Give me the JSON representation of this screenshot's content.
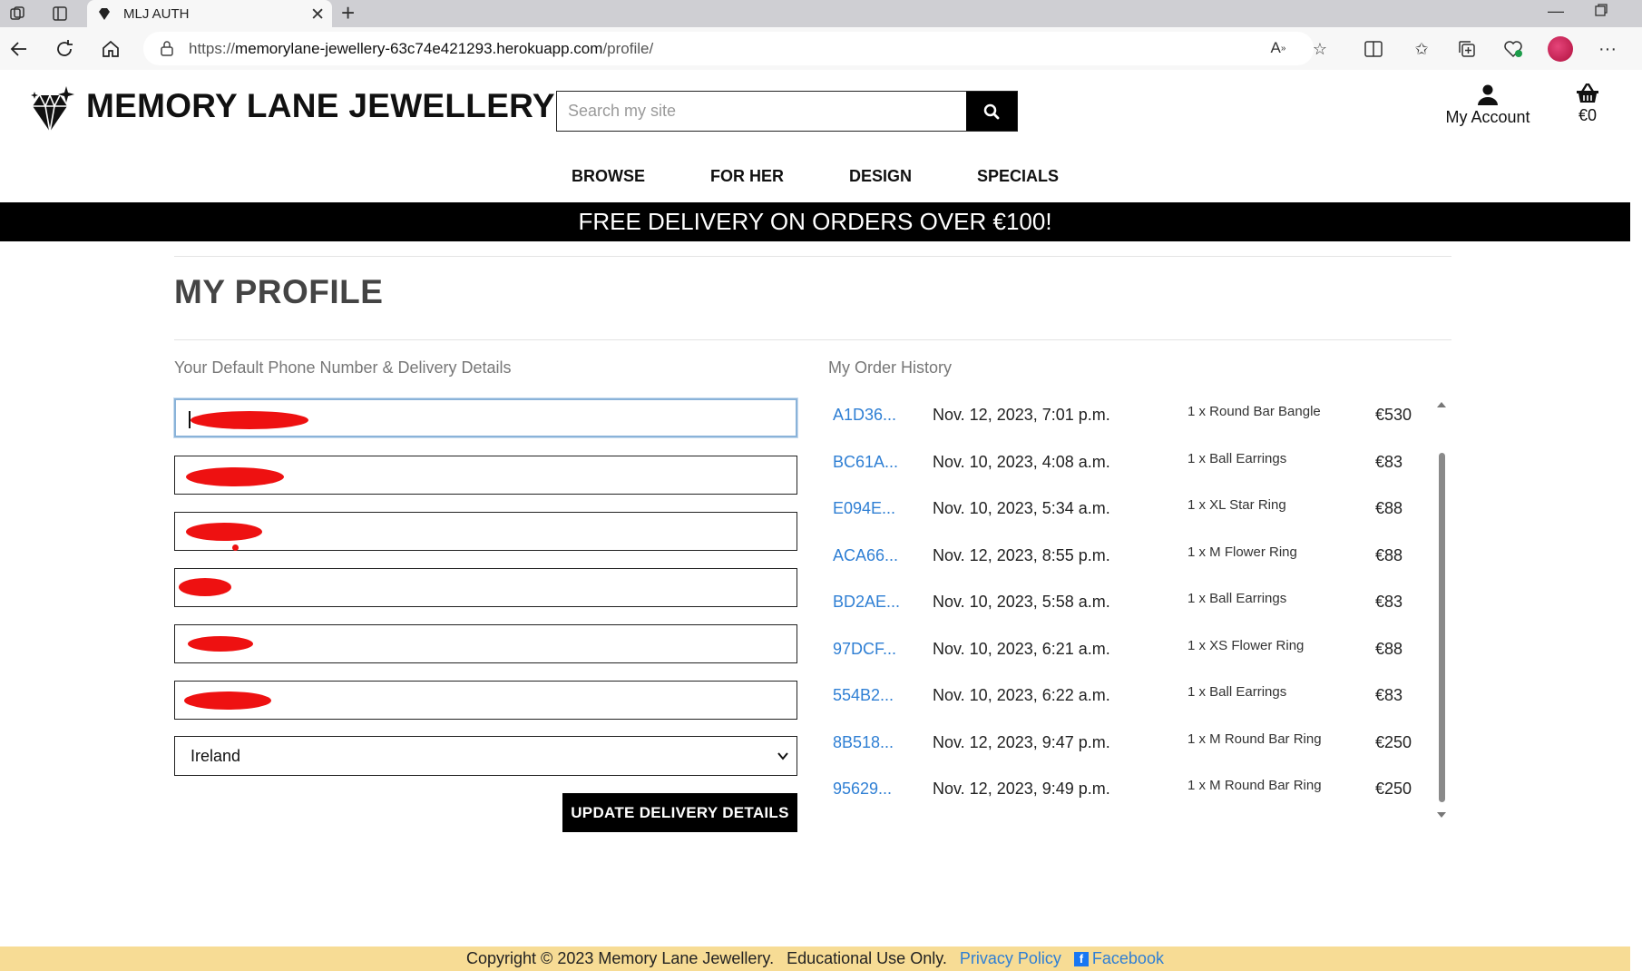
{
  "browser": {
    "tab_title": "MLJ AUTH",
    "url_prefix": "https://",
    "url_host": "memorylane-jewellery-63c74e421293.herokuapp.com",
    "url_path": "/profile/"
  },
  "header": {
    "brand": "MEMORY LANE JEWELLERY",
    "search_placeholder": "Search my site",
    "account_label": "My Account",
    "bag_total": "€0"
  },
  "nav": {
    "items": [
      {
        "label": "BROWSE"
      },
      {
        "label": "FOR HER"
      },
      {
        "label": "DESIGN"
      },
      {
        "label": "SPECIALS"
      }
    ]
  },
  "banner": "FREE DELIVERY ON ORDERS OVER €100!",
  "profile": {
    "title": "MY PROFILE",
    "delivery_heading": "Your Default Phone Number & Delivery Details",
    "country": "Ireland",
    "update_button": "UPDATE DELIVERY DETAILS"
  },
  "orders": {
    "heading": "My Order History",
    "rows": [
      {
        "number": "A1D36...",
        "date": "Nov. 12, 2023, 7:01 p.m.",
        "item": "1 x Round Bar Bangle",
        "price": "€530"
      },
      {
        "number": "BC61A...",
        "date": "Nov. 10, 2023, 4:08 a.m.",
        "item": "1 x Ball Earrings",
        "price": "€83"
      },
      {
        "number": "E094E...",
        "date": "Nov. 10, 2023, 5:34 a.m.",
        "item": "1 x XL Star Ring",
        "price": "€88"
      },
      {
        "number": "ACA66...",
        "date": "Nov. 12, 2023, 8:55 p.m.",
        "item": "1 x M Flower Ring",
        "price": "€88"
      },
      {
        "number": "BD2AE...",
        "date": "Nov. 10, 2023, 5:58 a.m.",
        "item": "1 x Ball Earrings",
        "price": "€83"
      },
      {
        "number": "97DCF...",
        "date": "Nov. 10, 2023, 6:21 a.m.",
        "item": "1 x XS Flower Ring",
        "price": "€88"
      },
      {
        "number": "554B2...",
        "date": "Nov. 10, 2023, 6:22 a.m.",
        "item": "1 x Ball Earrings",
        "price": "€83"
      },
      {
        "number": "8B518...",
        "date": "Nov. 12, 2023, 9:47 p.m.",
        "item": "1 x M Round Bar Ring",
        "price": "€250"
      },
      {
        "number": "95629...",
        "date": "Nov. 12, 2023, 9:49 p.m.",
        "item": "1 x M Round Bar Ring",
        "price": "€250"
      }
    ]
  },
  "footer": {
    "copyright": "Copyright © 2023 Memory Lane Jewellery.",
    "edu": "Educational Use Only.",
    "privacy": "Privacy Policy",
    "facebook": "Facebook"
  },
  "colors": {
    "link": "#2f7fd4",
    "footer_bg": "#f7dc95",
    "banner_bg": "#000000",
    "redaction": "#ee1111"
  }
}
